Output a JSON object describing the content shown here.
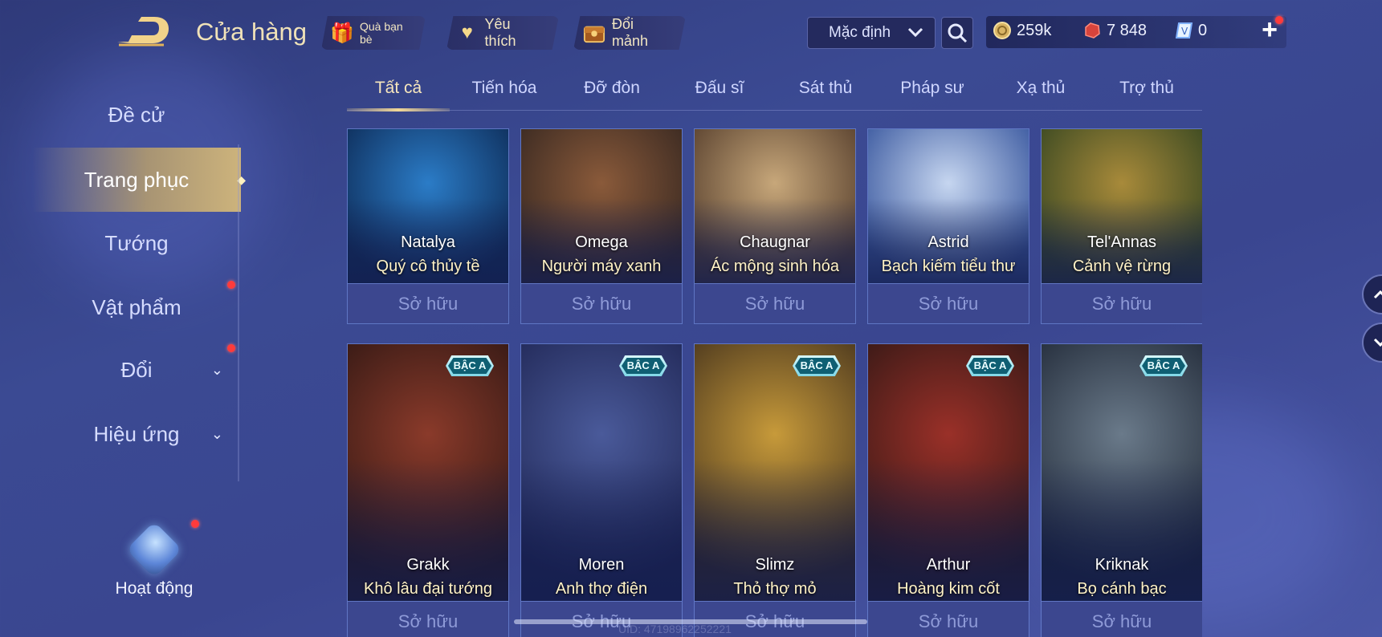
{
  "header": {
    "title": "Cửa hàng",
    "pills": [
      {
        "label": "Quà bạn bè",
        "icon": "gift-icon"
      },
      {
        "label": "Yêu thích",
        "icon": "heart-icon"
      },
      {
        "label": "Đổi mảnh",
        "icon": "chest-icon"
      }
    ],
    "sort": {
      "value": "Mặc định"
    },
    "currencies": [
      {
        "icon": "gold-coin-icon",
        "value": "259k"
      },
      {
        "icon": "ruby-icon",
        "value": "7 848"
      },
      {
        "icon": "voucher-icon",
        "value": "0"
      }
    ]
  },
  "sidebar": {
    "items": [
      {
        "label": "Đề cử"
      },
      {
        "label": "Trang phục"
      },
      {
        "label": "Tướng"
      },
      {
        "label": "Vật phẩm"
      },
      {
        "label": "Đổi"
      },
      {
        "label": "Hiệu ứng"
      }
    ],
    "activity_label": "Hoạt động"
  },
  "tabs": [
    "Tất cả",
    "Tiến hóa",
    "Đỡ đòn",
    "Đấu sĩ",
    "Sát thủ",
    "Pháp sư",
    "Xạ thủ",
    "Trợ thủ"
  ],
  "cards_row1": [
    {
      "hero": "Natalya",
      "skin": "Quý cô thủy tề",
      "status": "Sở hữu",
      "color1": "#2b7cc7",
      "color2": "#0f2f5c"
    },
    {
      "hero": "Omega",
      "skin": "Người máy xanh",
      "status": "Sở hữu",
      "color1": "#8a5a3a",
      "color2": "#3b2a22"
    },
    {
      "hero": "Chaugnar",
      "skin": "Ác mộng sinh hóa",
      "status": "Sở hữu",
      "color1": "#c7a77a",
      "color2": "#5b4330"
    },
    {
      "hero": "Astrid",
      "skin": "Bạch kiếm tiểu thư",
      "status": "Sở hữu",
      "color1": "#c6d6f0",
      "color2": "#3c5aa0"
    },
    {
      "hero": "Tel'Annas",
      "skin": "Cảnh vệ rừng",
      "status": "Sở hữu",
      "color1": "#a88a3a",
      "color2": "#3c4a22"
    }
  ],
  "cards_row2": [
    {
      "hero": "Grakk",
      "skin": "Khô lâu đại tướng",
      "status": "Sở hữu",
      "badge": "BẬC A",
      "color1": "#8a3a2a",
      "color2": "#2a1512"
    },
    {
      "hero": "Moren",
      "skin": "Anh thợ điện",
      "status": "Sở hữu",
      "badge": "BẬC A",
      "color1": "#4a5a9a",
      "color2": "#1d2350"
    },
    {
      "hero": "Slimz",
      "skin": "Thỏ thợ mỏ",
      "status": "Sở hữu",
      "badge": "BẬC A",
      "color1": "#c79a3a",
      "color2": "#3a2a1a"
    },
    {
      "hero": "Arthur",
      "skin": "Hoàng kim cốt",
      "status": "Sở hữu",
      "badge": "BẬC A",
      "color1": "#9a3028",
      "color2": "#2a1614"
    },
    {
      "hero": "Kriknak",
      "skin": "Bọ cánh bạc",
      "status": "Sở hữu",
      "badge": "BẬC A",
      "color1": "#6a7a8a",
      "color2": "#1a2230"
    }
  ],
  "footer": {
    "uid": "UID: 47198962252221"
  }
}
